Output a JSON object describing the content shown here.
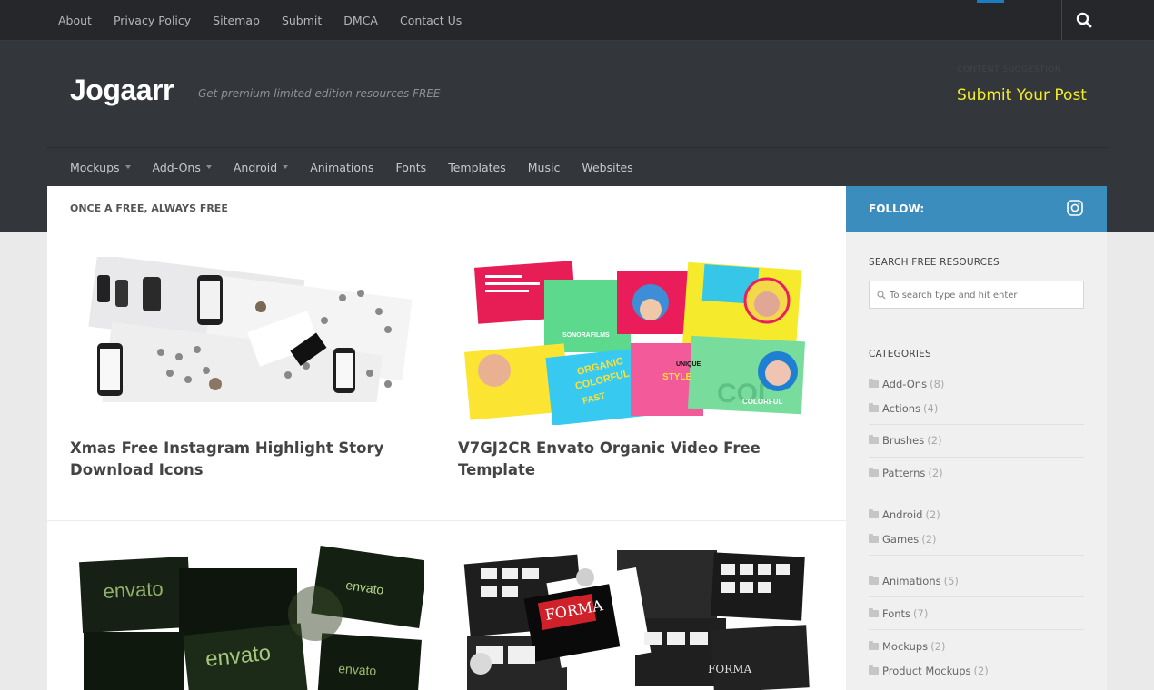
{
  "topnav": {
    "items": [
      "About",
      "Privacy Policy",
      "Sitemap",
      "Submit",
      "DMCA",
      "Contact Us"
    ]
  },
  "header": {
    "logo": "Jogaarr",
    "tagline": "Get premium limited edition resources FREE",
    "ad_label": "CONTENT SUGGESTION",
    "ad_link": "Submit Your Post"
  },
  "mainnav": {
    "items": [
      {
        "label": "Mockups",
        "dropdown": true
      },
      {
        "label": "Add-Ons",
        "dropdown": true
      },
      {
        "label": "Android",
        "dropdown": true
      },
      {
        "label": "Animations",
        "dropdown": false
      },
      {
        "label": "Fonts",
        "dropdown": false
      },
      {
        "label": "Templates",
        "dropdown": false
      },
      {
        "label": "Music",
        "dropdown": false
      },
      {
        "label": "Websites",
        "dropdown": false
      }
    ]
  },
  "content": {
    "heading": "ONCE A FREE, ALWAYS FREE",
    "posts": [
      {
        "title": "Xmas Free Instagram Highlight Story Download Icons"
      },
      {
        "title": "V7GJ2CR Envato Organic Video Free Template"
      },
      {
        "title": "",
        "thumb_text": [
          "envato",
          "envato",
          "envato",
          "envato"
        ]
      },
      {
        "title": "",
        "thumb_text": [
          "FORMA",
          "FORMA"
        ]
      }
    ],
    "thumb_words": {
      "organic": "ORGANIC",
      "colorful": "COLORFUL",
      "fast": "FAST",
      "sonora": "SONORAFILMS",
      "unique": "UNIQUE",
      "style": "STYLE",
      "col": "COL"
    }
  },
  "sidebar": {
    "follow_label": "FOLLOW:",
    "search_heading": "SEARCH FREE RESOURCES",
    "search_placeholder": "To search type and hit enter",
    "categories_heading": "CATEGORIES",
    "categories": [
      {
        "name": "Add-Ons",
        "count": "(8)"
      },
      {
        "name": "Actions",
        "count": "(4)"
      },
      {
        "name": "Brushes",
        "count": "(2)"
      },
      {
        "name": "Patterns",
        "count": "(2)"
      },
      {
        "name": "Android",
        "count": "(2)"
      },
      {
        "name": "Games",
        "count": "(2)"
      },
      {
        "name": "Animations",
        "count": "(5)"
      },
      {
        "name": "Fonts",
        "count": "(7)"
      },
      {
        "name": "Mockups",
        "count": "(2)"
      },
      {
        "name": "Product Mockups",
        "count": "(2)"
      }
    ]
  },
  "colors": {
    "accent_blue": "#3b8dbd",
    "ad_yellow": "#f3ec2b",
    "header_bg": "#33363b",
    "topbar_bg": "#26272b"
  },
  "icons": {
    "search": "search-icon",
    "instagram": "instagram-icon",
    "folder": "folder-icon",
    "caret": "chevron-down-icon"
  }
}
